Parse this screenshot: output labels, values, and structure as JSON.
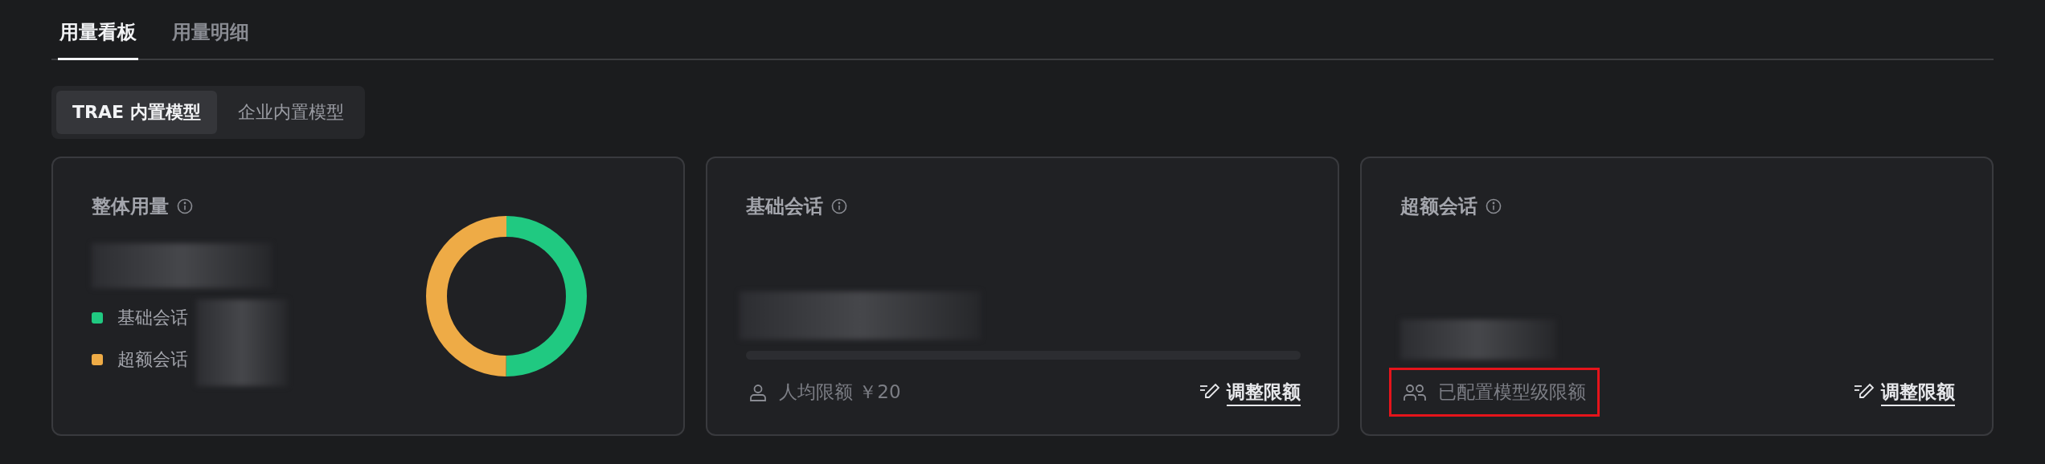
{
  "tabs": [
    {
      "label": "用量看板",
      "selected": true
    },
    {
      "label": "用量明细",
      "selected": false
    }
  ],
  "model_switch": [
    {
      "label": "TRAE 内置模型",
      "selected": true
    },
    {
      "label": "企业内置模型",
      "selected": false
    }
  ],
  "cards": [
    {
      "kind": "donut",
      "title": "整体用量",
      "legend": [
        {
          "label": "基础会话",
          "color": "#20c981"
        },
        {
          "label": "超额会话",
          "color": "#eeab46"
        }
      ]
    },
    {
      "kind": "per_user_quota",
      "title": "基础会话",
      "note": "人均限额 ￥20",
      "action": "调整限额",
      "highlighted": false
    },
    {
      "kind": "model_quota",
      "title": "超额会话",
      "note": "已配置模型级限额",
      "action": "调整限额",
      "highlighted": true
    }
  ]
}
